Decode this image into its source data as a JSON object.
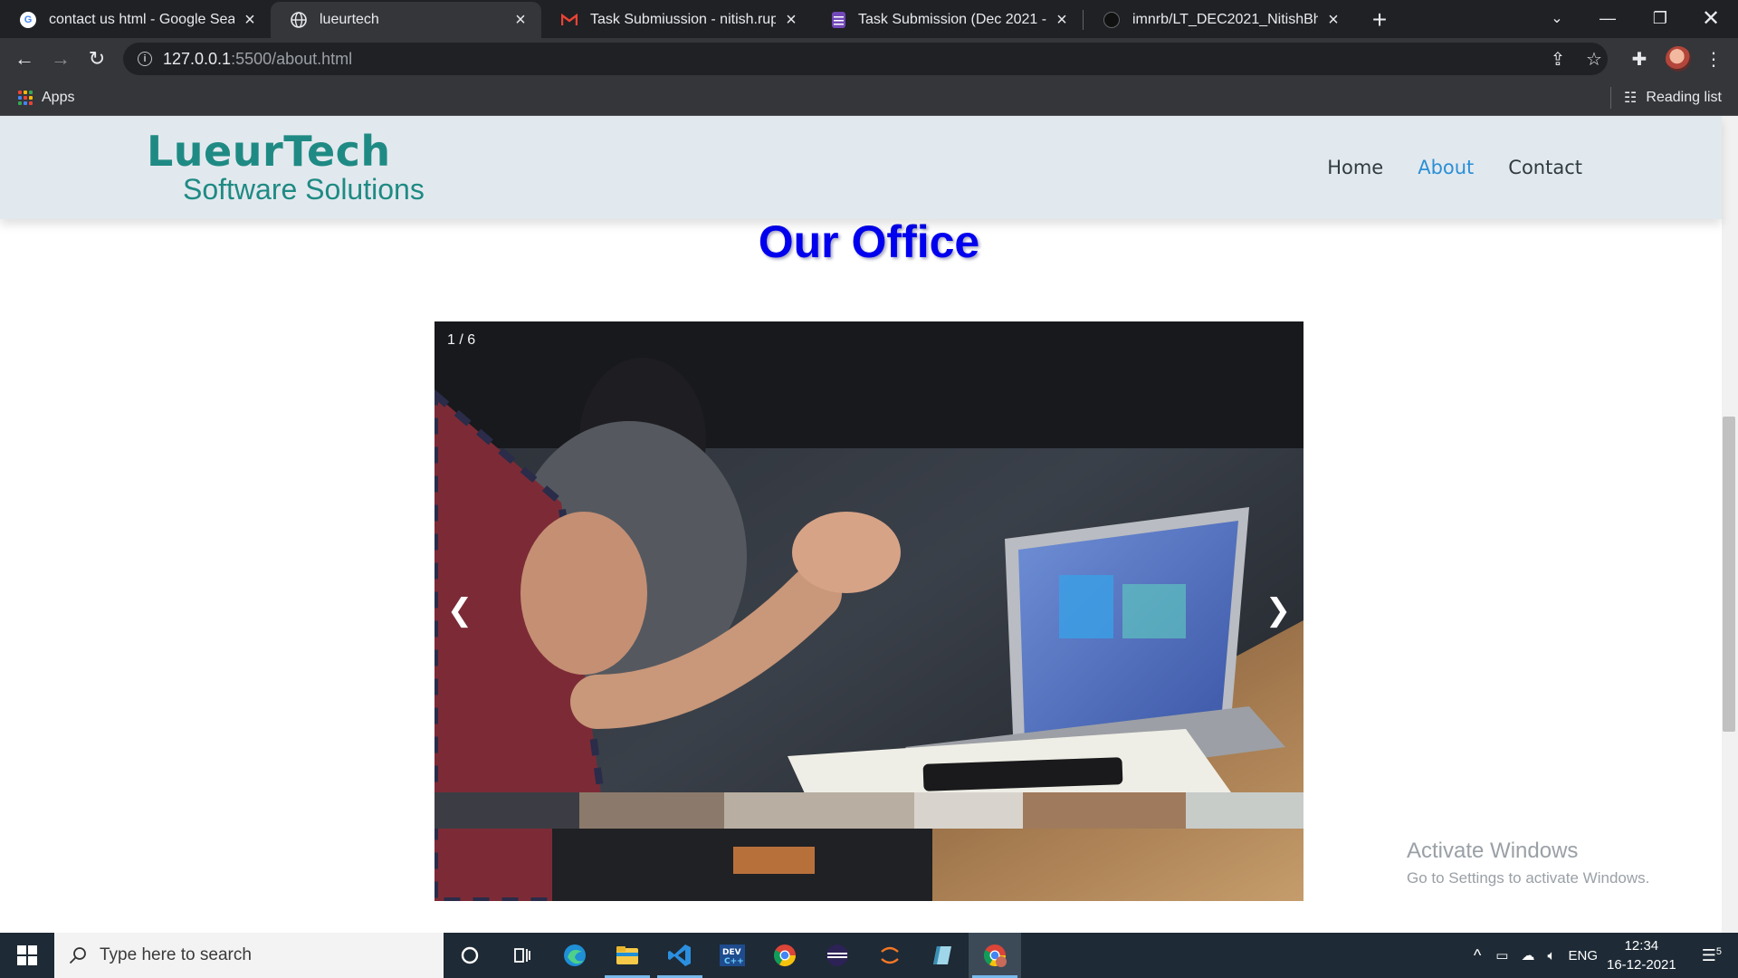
{
  "browser": {
    "tabs": [
      {
        "title": "contact us html - Google Search",
        "favicon": "google-icon",
        "active": false
      },
      {
        "title": "lueurtech",
        "favicon": "globe-icon",
        "active": true
      },
      {
        "title": "Task Submiussion - nitish.rupak@",
        "favicon": "gmail-icon",
        "active": false
      },
      {
        "title": "Task Submission (Dec 2021 - Batc",
        "favicon": "forms-icon",
        "active": false
      },
      {
        "title": "imnrb/LT_DEC2021_NitishBhattac",
        "favicon": "github-icon",
        "active": false
      }
    ],
    "url_host": "127.0.0.1",
    "url_path": ":5500/about.html",
    "bookmarks": {
      "apps_label": "Apps",
      "reading_list_label": "Reading list"
    }
  },
  "site": {
    "brand_name": "LueurTech",
    "brand_tagline": "Software Solutions",
    "nav": [
      {
        "label": "Home",
        "active": false
      },
      {
        "label": "About",
        "active": true
      },
      {
        "label": "Contact",
        "active": false
      }
    ],
    "heading": "Our Office",
    "slideshow": {
      "counter": "1 / 6",
      "prev": "❮",
      "next": "❯"
    }
  },
  "windows": {
    "watermark_title": "Activate Windows",
    "watermark_sub": "Go to Settings to activate Windows.",
    "search_placeholder": "Type here to search",
    "language": "ENG",
    "time": "12:34",
    "date": "16-12-2021",
    "notifications": "5"
  },
  "colors": {
    "brand": "#1f8a84",
    "nav_active": "#2b8fd6",
    "heading": "#0000ee",
    "header_bg": "#e2e9ee"
  }
}
